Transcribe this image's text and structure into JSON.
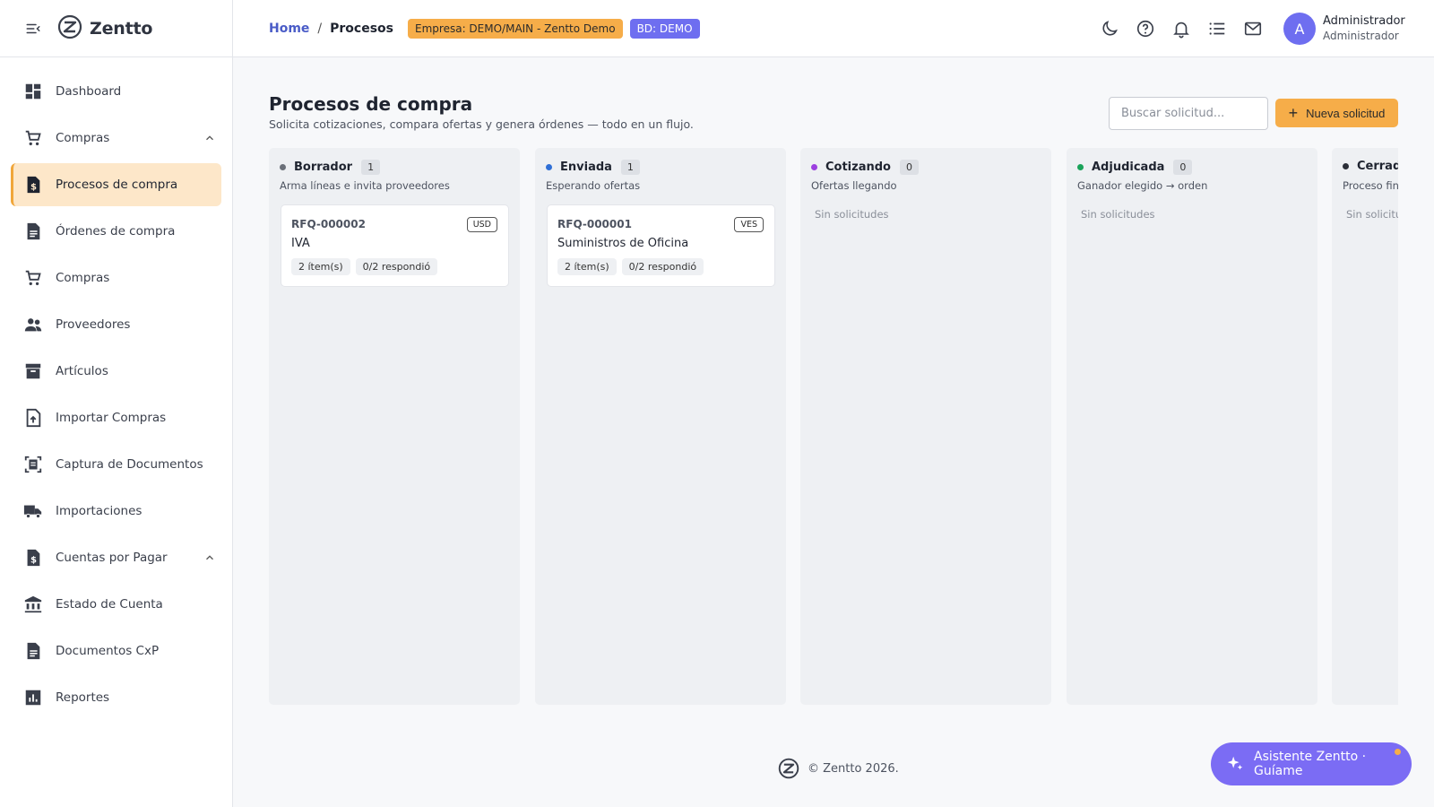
{
  "app": {
    "name": "Zentto"
  },
  "sidebar": {
    "items": [
      {
        "label": "Dashboard",
        "icon": "dashboard-icon"
      },
      {
        "label": "Compras",
        "icon": "cart-icon",
        "expandable": true
      },
      {
        "label": "Procesos de compra",
        "icon": "invoice-dollar-icon",
        "active": true
      },
      {
        "label": "Órdenes de compra",
        "icon": "document-icon"
      },
      {
        "label": "Compras",
        "icon": "cart-icon"
      },
      {
        "label": "Proveedores",
        "icon": "people-icon"
      },
      {
        "label": "Artículos",
        "icon": "archive-icon"
      },
      {
        "label": "Importar Compras",
        "icon": "file-upload-icon"
      },
      {
        "label": "Captura de Documentos",
        "icon": "document-scanner-icon"
      },
      {
        "label": "Importaciones",
        "icon": "truck-icon"
      },
      {
        "label": "Cuentas por Pagar",
        "icon": "invoice-dollar-icon",
        "expandable": true
      },
      {
        "label": "Estado de Cuenta",
        "icon": "bank-icon"
      },
      {
        "label": "Documentos CxP",
        "icon": "document-icon"
      },
      {
        "label": "Reportes",
        "icon": "bar-chart-icon"
      }
    ]
  },
  "header": {
    "breadcrumb": {
      "home": "Home",
      "separator": "/",
      "current": "Procesos"
    },
    "empresa_badge": "Empresa: DEMO/MAIN - Zentto Demo",
    "bd_badge": "BD: DEMO",
    "icons": [
      "moon-icon",
      "help-icon",
      "bell-icon",
      "list-icon",
      "mail-icon"
    ],
    "user": {
      "initial": "A",
      "name": "Administrador",
      "role": "Administrador"
    }
  },
  "main": {
    "title": "Procesos de compra",
    "subtitle": "Solicita cotizaciones, compara ofertas y genera órdenes — todo en un flujo.",
    "search_placeholder": "Buscar solicitud...",
    "new_button": "Nueva solicitud",
    "columns": [
      {
        "name": "Borrador",
        "count": "1",
        "description": "Arma líneas e invita proveedores",
        "color": "#6b7079",
        "cards": [
          {
            "id": "RFQ-000002",
            "currency": "USD",
            "title": "IVA",
            "items": "2 ítem(s)",
            "responded": "0/2 respondió"
          }
        ]
      },
      {
        "name": "Enviada",
        "count": "1",
        "description": "Esperando ofertas",
        "color": "#2f6fd6",
        "cards": [
          {
            "id": "RFQ-000001",
            "currency": "VES",
            "title": "Suministros de Oficina",
            "items": "2 ítem(s)",
            "responded": "0/2 respondió"
          }
        ]
      },
      {
        "name": "Cotizando",
        "count": "0",
        "description": "Ofertas llegando",
        "color": "#9c3fe0",
        "empty": "Sin solicitudes",
        "cards": []
      },
      {
        "name": "Adjudicada",
        "count": "0",
        "description": "Ganador elegido → orden",
        "color": "#1aa35a",
        "empty": "Sin solicitudes",
        "cards": []
      },
      {
        "name": "Cerrada",
        "count": "",
        "description": "Proceso fina",
        "color": "#2b2f38",
        "empty": "Sin solicitu",
        "cards": []
      }
    ]
  },
  "footer": {
    "copyright": "© Zentto 2026."
  },
  "assistant": {
    "label": "Asistente Zentto · Guíame"
  },
  "colors": {
    "accent": "#f6ad49",
    "brand": "#6e6ef0",
    "assistant": "#7b6cf4",
    "active_bg": "#fde7c9"
  }
}
